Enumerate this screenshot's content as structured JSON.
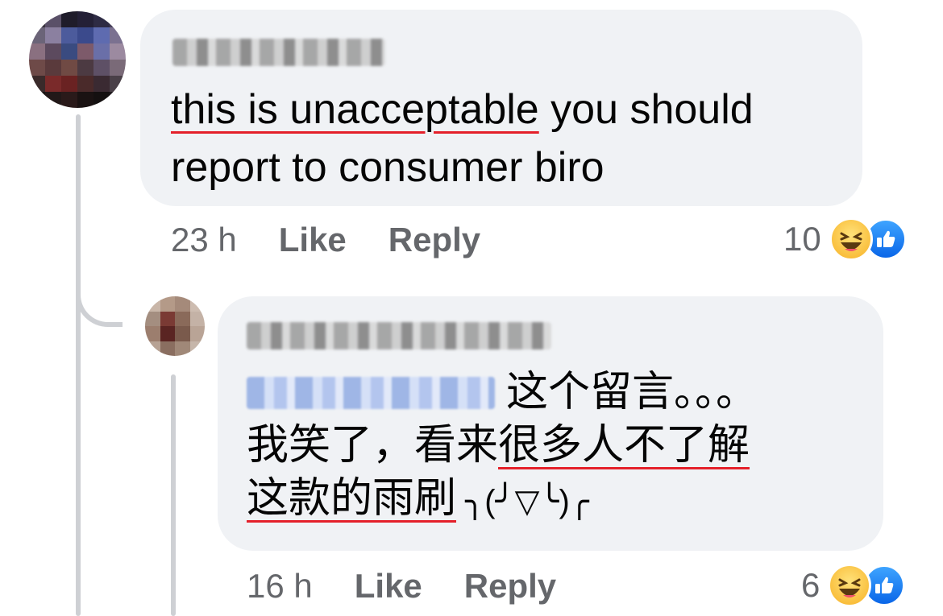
{
  "comment": {
    "text_part1": "this is unacceptable",
    "text_part2": " you should",
    "text_line2": "report to consumer biro",
    "time": "23 h",
    "like_label": "Like",
    "reply_label": "Reply",
    "reaction_count": "10"
  },
  "reply": {
    "mention_trailing": "这个留言。。。",
    "line2_a": "我笑了，看来",
    "line2_b": "很多人不了解",
    "line3_a": "这款的雨刷",
    "line3_b": " ╮(╯▽╰)╭",
    "time": "16 h",
    "like_label": "Like",
    "reply_label": "Reply",
    "reaction_count": "6"
  },
  "icons": {
    "haha": "haha-reaction-icon",
    "like": "like-reaction-icon"
  },
  "colors": {
    "bubble": "#f0f2f5",
    "meta_text": "#65676b",
    "spell_underline": "#e4202a",
    "like_blue": "#1877f2"
  }
}
